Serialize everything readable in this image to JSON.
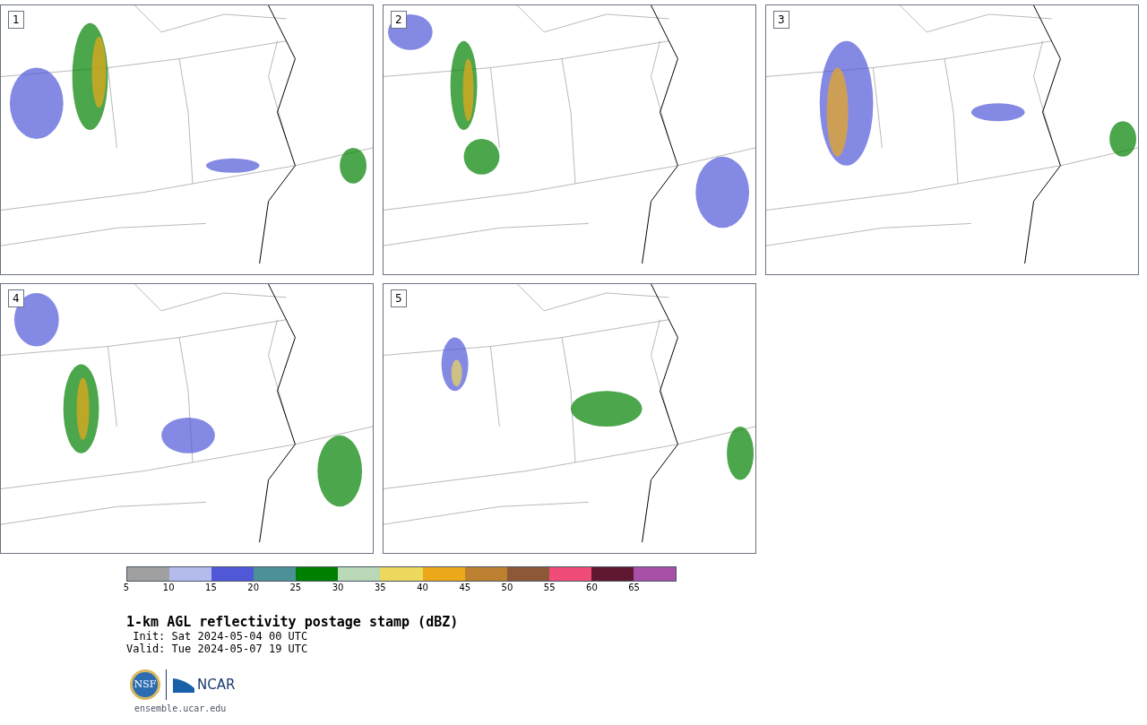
{
  "panels": [
    {
      "label": "1"
    },
    {
      "label": "2"
    },
    {
      "label": "3"
    },
    {
      "label": "4"
    },
    {
      "label": "5"
    }
  ],
  "colorbar": {
    "bins": [
      {
        "color": "#a0a0a0"
      },
      {
        "color": "#b4bcec"
      },
      {
        "color": "#5058d8"
      },
      {
        "color": "#4c9098"
      },
      {
        "color": "#008000"
      },
      {
        "color": "#b8d8b8"
      },
      {
        "color": "#ecd85c"
      },
      {
        "color": "#eca818"
      },
      {
        "color": "#bc8030"
      },
      {
        "color": "#8c5838"
      },
      {
        "color": "#f04c78"
      },
      {
        "color": "#601830"
      },
      {
        "color": "#a850a8"
      }
    ],
    "ticks": [
      "5",
      "10",
      "15",
      "20",
      "25",
      "30",
      "35",
      "40",
      "45",
      "50",
      "55",
      "60",
      "65"
    ]
  },
  "title": "1-km AGL reflectivity postage stamp (dBZ)",
  "init": " Init: Sat 2024-05-04 00 UTC",
  "valid": "Valid: Tue 2024-05-07 19 UTC",
  "logo": {
    "nsf": "NSF",
    "ncar": "NCAR"
  },
  "url": "ensemble.ucar.edu"
}
